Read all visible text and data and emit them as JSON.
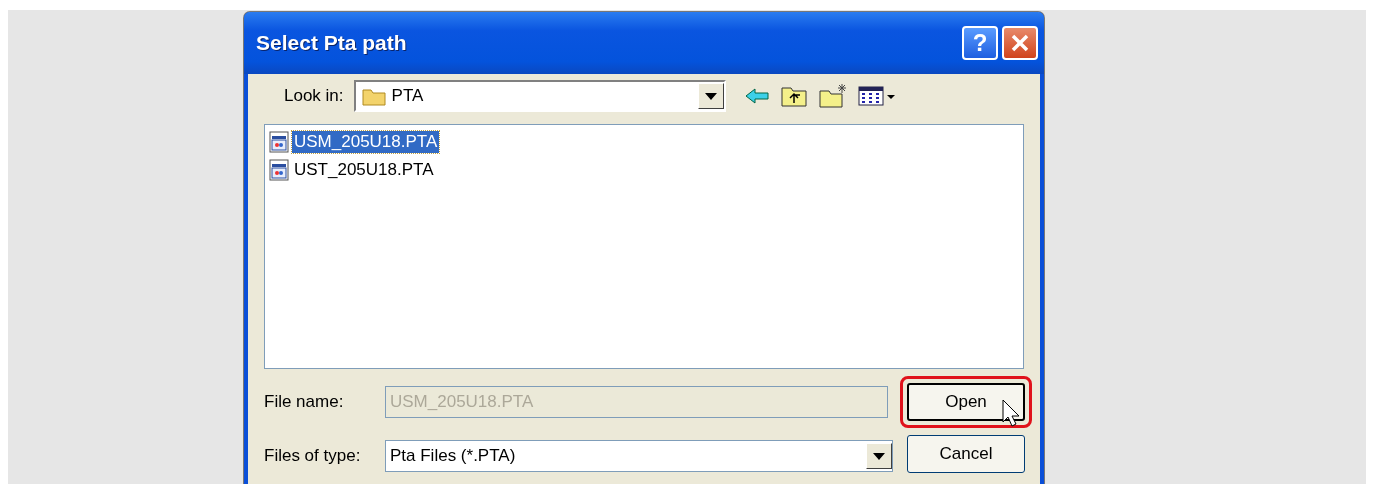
{
  "window": {
    "title": "Select Pta path",
    "help_button": "?"
  },
  "look_in": {
    "label": "Look in:",
    "value": "PTA"
  },
  "files": [
    {
      "name": "USM_205U18.PTA",
      "selected": true
    },
    {
      "name": "UST_205U18.PTA",
      "selected": false
    }
  ],
  "file_name": {
    "label": "File name:",
    "value": "USM_205U18.PTA",
    "disabled": true
  },
  "file_type": {
    "label": "Files of type:",
    "value": "Pta Files (*.PTA)"
  },
  "buttons": [
    {
      "label": "Open",
      "highlighted": true
    },
    {
      "label": "Cancel",
      "highlighted": false
    }
  ]
}
